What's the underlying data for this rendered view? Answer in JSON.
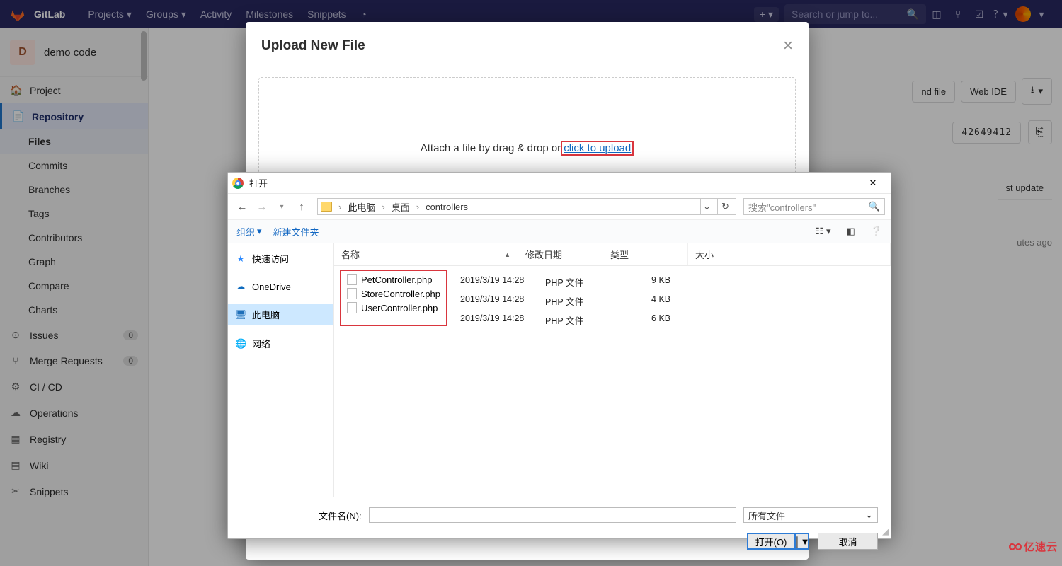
{
  "nav": {
    "brand": "GitLab",
    "links": [
      "Projects",
      "Groups",
      "Activity",
      "Milestones",
      "Snippets"
    ],
    "search_placeholder": "Search or jump to...",
    "plus_label": "+"
  },
  "project": {
    "letter": "D",
    "name": "demo code"
  },
  "sidebar": {
    "items": [
      {
        "icon": "🏠",
        "label": "Project"
      },
      {
        "icon": "📄",
        "label": "Repository"
      },
      {
        "icon": "⊙",
        "label": "Issues",
        "badge": "0"
      },
      {
        "icon": "⑂",
        "label": "Merge Requests",
        "badge": "0"
      },
      {
        "icon": "⚙",
        "label": "CI / CD"
      },
      {
        "icon": "☁",
        "label": "Operations"
      },
      {
        "icon": "▦",
        "label": "Registry"
      },
      {
        "icon": "▤",
        "label": "Wiki"
      },
      {
        "icon": "✂",
        "label": "Snippets"
      }
    ],
    "subitems": [
      "Files",
      "Commits",
      "Branches",
      "Tags",
      "Contributors",
      "Graph",
      "Compare",
      "Charts"
    ]
  },
  "main": {
    "row1": {
      "find_file": "nd file",
      "web_ide": "Web IDE"
    },
    "hash": "42649412",
    "th_update": "st update",
    "tr_utes": "utes ago"
  },
  "modal": {
    "title": "Upload New File",
    "drop_text": "Attach a file by drag & drop or ",
    "drop_link": "click to upload"
  },
  "filedlg": {
    "title": "打开",
    "crumbs": [
      "此电脑",
      "桌面",
      "controllers"
    ],
    "search_placeholder": "搜索\"controllers\"",
    "toolbar": {
      "org": "组织",
      "newfolder": "新建文件夹"
    },
    "tree": [
      {
        "icon": "★",
        "label": "快速访问",
        "cls": "starblue"
      },
      {
        "icon": "☁",
        "label": "OneDrive",
        "cls": "cloudic"
      },
      {
        "icon": "🖥",
        "label": "此电脑",
        "cls": "monitoric",
        "sel": true
      },
      {
        "icon": "🌐",
        "label": "网络",
        "cls": ""
      }
    ],
    "columns": [
      "名称",
      "修改日期",
      "类型",
      "大小"
    ],
    "files": [
      {
        "name": "PetController.php",
        "date": "2019/3/19 14:28",
        "type": "PHP 文件",
        "size": "9 KB"
      },
      {
        "name": "StoreController.php",
        "date": "2019/3/19 14:28",
        "type": "PHP 文件",
        "size": "4 KB"
      },
      {
        "name": "UserController.php",
        "date": "2019/3/19 14:28",
        "type": "PHP 文件",
        "size": "6 KB"
      }
    ],
    "filename_label": "文件名(N):",
    "filter": "所有文件",
    "open_btn": "打开(O)",
    "cancel_btn": "取消"
  },
  "watermark": "亿速云"
}
